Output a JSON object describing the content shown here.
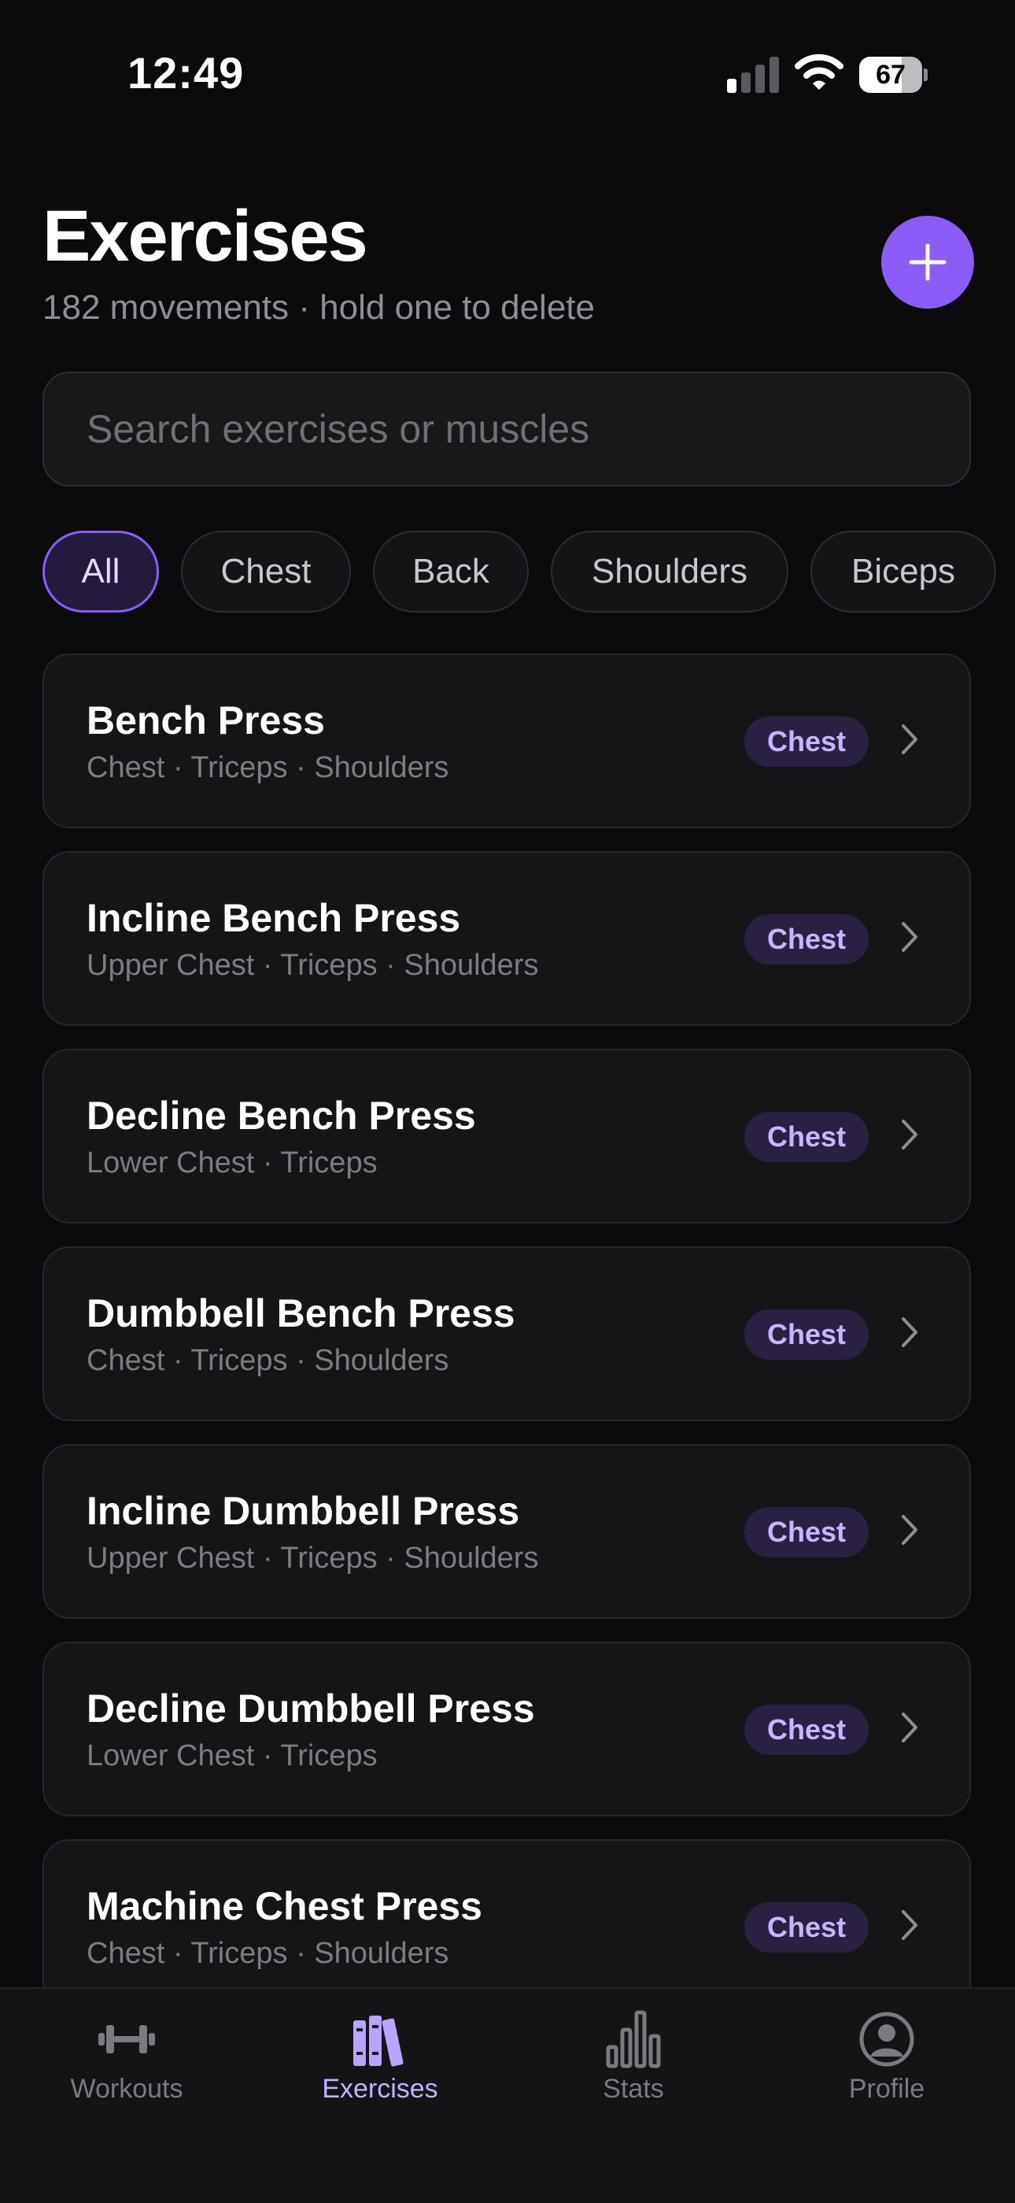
{
  "status_bar": {
    "time": "12:49",
    "battery_percent": 67,
    "battery_label": "67",
    "signal_bars_active": 1,
    "signal_bars_total": 4
  },
  "header": {
    "title": "Exercises",
    "subtitle": "182 movements · hold one to delete",
    "add_button_icon": "plus-icon"
  },
  "search": {
    "placeholder": "Search exercises or muscles",
    "value": ""
  },
  "filters": [
    {
      "label": "All",
      "active": true
    },
    {
      "label": "Chest",
      "active": false
    },
    {
      "label": "Back",
      "active": false
    },
    {
      "label": "Shoulders",
      "active": false
    },
    {
      "label": "Biceps",
      "active": false
    }
  ],
  "exercises": [
    {
      "name": "Bench Press",
      "muscles": "Chest · Triceps · Shoulders",
      "category": "Chest"
    },
    {
      "name": "Incline Bench Press",
      "muscles": "Upper Chest · Triceps · Shoulders",
      "category": "Chest"
    },
    {
      "name": "Decline Bench Press",
      "muscles": "Lower Chest · Triceps",
      "category": "Chest"
    },
    {
      "name": "Dumbbell Bench Press",
      "muscles": "Chest · Triceps · Shoulders",
      "category": "Chest"
    },
    {
      "name": "Incline Dumbbell Press",
      "muscles": "Upper Chest · Triceps · Shoulders",
      "category": "Chest"
    },
    {
      "name": "Decline Dumbbell Press",
      "muscles": "Lower Chest · Triceps",
      "category": "Chest"
    },
    {
      "name": "Machine Chest Press",
      "muscles": "Chest · Triceps · Shoulders",
      "category": "Chest"
    }
  ],
  "tab_bar": {
    "tabs": [
      {
        "label": "Workouts",
        "icon": "dumbbell-icon",
        "active": false
      },
      {
        "label": "Exercises",
        "icon": "books-icon",
        "active": true
      },
      {
        "label": "Stats",
        "icon": "bar-chart-icon",
        "active": false
      },
      {
        "label": "Profile",
        "icon": "profile-icon",
        "active": false
      }
    ]
  },
  "colors": {
    "background": "#0b0b0d",
    "accent": "#8b5cf6",
    "card": "#151518",
    "badge_bg": "#2a2142",
    "badge_text": "#c9b5ff",
    "muted_text": "#8e8e93"
  }
}
